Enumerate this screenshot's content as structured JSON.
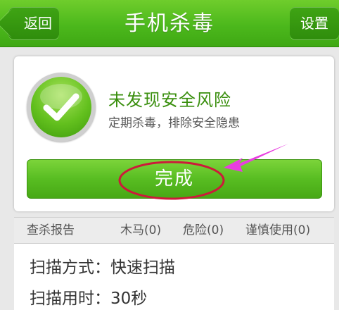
{
  "header": {
    "back_label": "返回",
    "title": "手机杀毒",
    "settings_label": "设置"
  },
  "status": {
    "icon": "checkmark-icon",
    "title": "未发现安全风险",
    "subtitle": "定期杀毒，排除安全隐患"
  },
  "actions": {
    "done_label": "完成"
  },
  "report": {
    "label": "查杀报告",
    "trojan": "木马(0)",
    "danger": "危险(0)",
    "caution": "谨慎使用(0)"
  },
  "details": {
    "scan_mode": "扫描方式：快速扫描",
    "scan_time": "扫描用时：30秒"
  },
  "colors": {
    "brand_green": "#4cb81c",
    "annotation": "#cc1a3a",
    "arrow": "#e83ee0"
  }
}
